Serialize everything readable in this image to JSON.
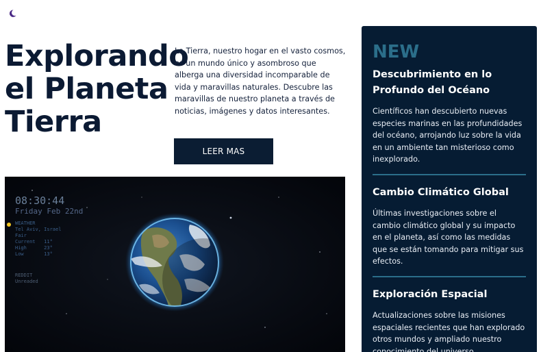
{
  "theme": {
    "accent": "#0b1d33",
    "panel_bg": "#061c33",
    "panel_accent": "#2b6e8a",
    "moon_color": "#4b2a86"
  },
  "header": {
    "theme_toggle_icon": "moon-icon"
  },
  "hero": {
    "title": "Explorando el Planeta Tierra",
    "description": "La Tierra, nuestro hogar en el vasto cosmos, es un mundo único y asombroso que alberga una diversidad incomparable de vida y maravillas naturales. Descubre las maravillas de nuestro planeta a través de noticias, imágenes y datos interesantes.",
    "cta_label": "LEER MAS"
  },
  "wallpaper": {
    "clock": "08:30:44",
    "date": "Friday Feb 22nd",
    "weather_label": "WEATHER",
    "weather_location": "Tel Aviv, Israel",
    "weather_cond": "Fair",
    "weather_rows": [
      {
        "label": "Current",
        "value": "11°"
      },
      {
        "label": "High",
        "value": "23°"
      },
      {
        "label": "Low",
        "value": "13°"
      }
    ],
    "reddit_label": "REDDIT",
    "reddit_sub": "Unreaded"
  },
  "news": {
    "heading": "NEW",
    "items": [
      {
        "title": "Descubrimiento en lo Profundo del Océano",
        "body": "Científicos han descubierto nuevas especies marinas en las profundidades del océano, arrojando luz sobre la vida en un ambiente tan misterioso como inexplorado."
      },
      {
        "title": "Cambio Climático Global",
        "body": "Últimas investigaciones sobre el cambio climático global y su impacto en el planeta, así como las medidas que se están tomando para mitigar sus efectos."
      },
      {
        "title": "Exploración Espacial",
        "body": "Actualizaciones sobre las misiones espaciales recientes que han explorado otros mundos y ampliado nuestro conocimiento del universo"
      }
    ]
  }
}
